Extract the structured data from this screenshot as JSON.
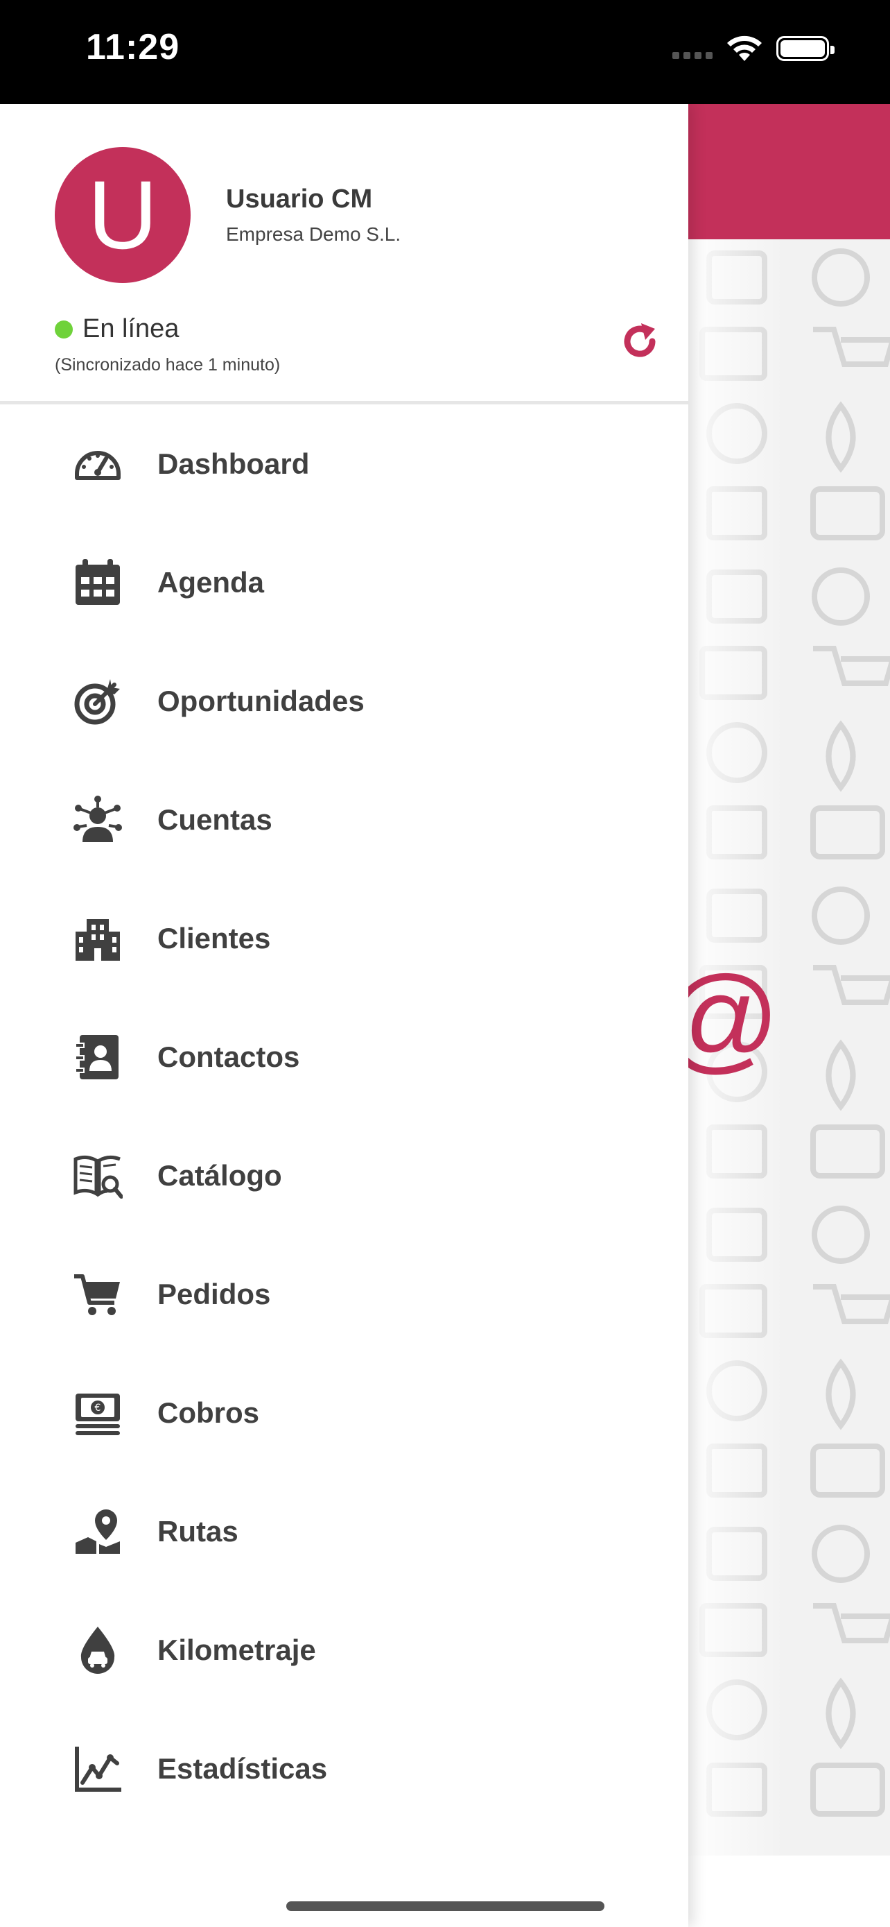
{
  "status_bar": {
    "time": "11:29"
  },
  "user": {
    "avatar_initial": "U",
    "name": "Usuario CM",
    "company": "Empresa Demo S.L.",
    "status": "En línea",
    "sync": "(Sincronizado hace 1 minuto)"
  },
  "colors": {
    "accent": "#c3305a",
    "online": "#6fd23a",
    "text": "#404040"
  },
  "menu": [
    {
      "label": "Dashboard",
      "icon": "dashboard-gauge-icon"
    },
    {
      "label": "Agenda",
      "icon": "calendar-icon"
    },
    {
      "label": "Oportunidades",
      "icon": "target-icon"
    },
    {
      "label": "Cuentas",
      "icon": "accounts-network-icon"
    },
    {
      "label": "Clientes",
      "icon": "building-icon"
    },
    {
      "label": "Contactos",
      "icon": "contact-book-icon"
    },
    {
      "label": "Catálogo",
      "icon": "catalog-book-icon"
    },
    {
      "label": "Pedidos",
      "icon": "shopping-cart-icon"
    },
    {
      "label": "Cobros",
      "icon": "money-stack-icon"
    },
    {
      "label": "Rutas",
      "icon": "map-pin-icon"
    },
    {
      "label": "Kilometraje",
      "icon": "fuel-drop-car-icon"
    },
    {
      "label": "Estadísticas",
      "icon": "line-chart-icon"
    }
  ],
  "background": {
    "at_symbol": "@"
  }
}
